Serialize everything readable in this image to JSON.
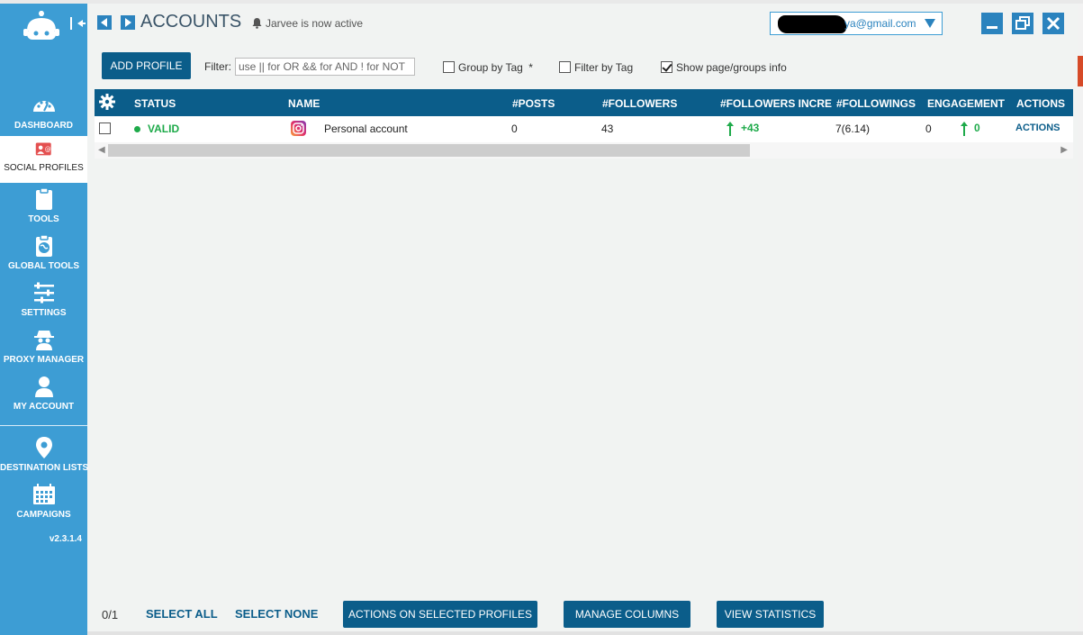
{
  "sidebar": {
    "items": [
      {
        "label": "DASHBOARD",
        "icon": "dashboard-icon"
      },
      {
        "label": "SOCIAL PROFILES",
        "icon": "social-profiles-icon",
        "active": true
      },
      {
        "label": "TOOLS",
        "icon": "clipboard-icon"
      },
      {
        "label": "GLOBAL TOOLS",
        "icon": "globe-clipboard-icon"
      },
      {
        "label": "SETTINGS",
        "icon": "sliders-icon"
      },
      {
        "label": "PROXY MANAGER",
        "icon": "spy-icon"
      },
      {
        "label": "MY ACCOUNT",
        "icon": "user-icon"
      },
      {
        "label": "DESTINATION LISTS",
        "icon": "map-pin-icon"
      },
      {
        "label": "CAMPAIGNS",
        "icon": "calendar-icon"
      }
    ],
    "version": "v2.3.1.4"
  },
  "header": {
    "title": "ACCOUNTS",
    "status": "Jarvee is now active",
    "account_email": "ya@gmail.com"
  },
  "toolbar": {
    "add_profile": "ADD PROFILE",
    "filter_label": "Filter:",
    "filter_placeholder": "use || for OR && for AND ! for NOT",
    "group_by_tag": "Group by Tag",
    "group_by_tag_mark": "*",
    "filter_by_tag": "Filter by Tag",
    "show_info": "Show page/groups info"
  },
  "table": {
    "columns": [
      "STATUS",
      "NAME",
      "#POSTS",
      "#FOLLOWERS",
      "#FOLLOWERS INCREA",
      "#FOLLOWINGS",
      "ENGAGEMENT",
      "ACTIONS"
    ],
    "rows": [
      {
        "status": "VALID",
        "name": "Personal account",
        "posts": "0",
        "followers": "43",
        "followers_increase": "+43",
        "followings": "7(6.14)",
        "engagement_a": "0",
        "engagement_b": "0",
        "actions": "ACTIONS"
      }
    ]
  },
  "footer": {
    "count": "0/1",
    "select_all": "SELECT ALL",
    "select_none": "SELECT NONE",
    "actions_selected": "ACTIONS ON SELECTED PROFILES",
    "manage_columns": "MANAGE COLUMNS",
    "view_statistics": "VIEW STATISTICS"
  },
  "colors": {
    "sidebar": "#3d9dd4",
    "primary": "#0b5d8a",
    "valid_green": "#1eaa4a"
  }
}
